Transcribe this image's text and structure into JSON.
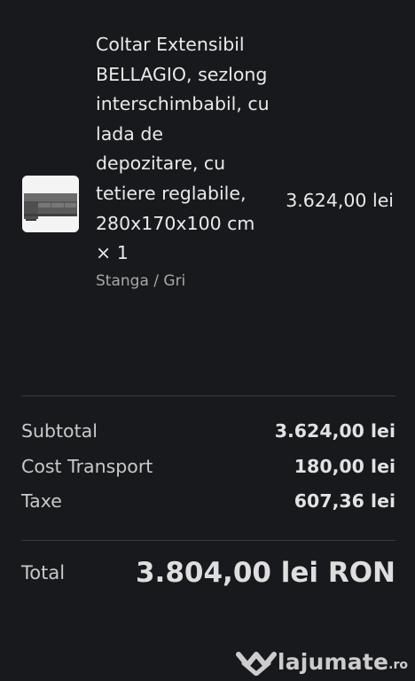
{
  "item": {
    "title": "Coltar Extensibil BELLAGIO, sezlong interschimbabil, cu lada de depozitare, cu tetiere reglabile, 280x170x100 cm × 1",
    "variant": "Stanga / Gri",
    "price": "3.624,00 lei",
    "image_icon": "sofa-thumbnail"
  },
  "summary": {
    "subtotal_label": "Subtotal",
    "subtotal_value": "3.624,00 lei",
    "shipping_label": "Cost Transport",
    "shipping_value": "180,00 lei",
    "taxes_label": "Taxe",
    "taxes_value": "607,36 lei"
  },
  "total": {
    "label": "Total",
    "value": "3.804,00 lei RON"
  },
  "watermark": {
    "name": "lajumate",
    "tld": ".ro"
  },
  "colors": {
    "background": "#18191c",
    "divider": "#3a3b3f",
    "muted_text": "#a8a8a8"
  }
}
